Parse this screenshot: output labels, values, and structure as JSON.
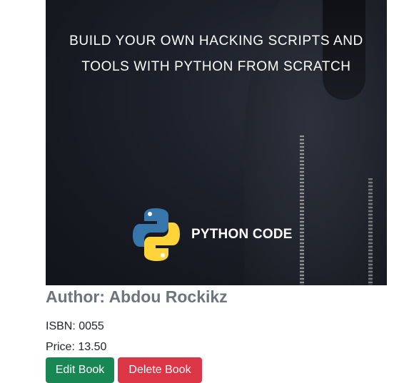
{
  "book": {
    "cover": {
      "title_line1": "BUILD YOUR OWN HACKING SCRIPTS AND",
      "title_line2": "TOOLS WITH PYTHON FROM SCRATCH",
      "logo_text": "PYTHON CODE",
      "logo_icon": "python-logo-icon"
    },
    "author": "Author: Abdou Rockikz",
    "isbn": "ISBN: 0055",
    "price": "Price: 13.50"
  },
  "actions": {
    "edit_label": "Edit Book",
    "delete_label": "Delete Book"
  },
  "colors": {
    "edit": "#198754",
    "delete": "#dc3545",
    "author_text": "#6c757d"
  }
}
